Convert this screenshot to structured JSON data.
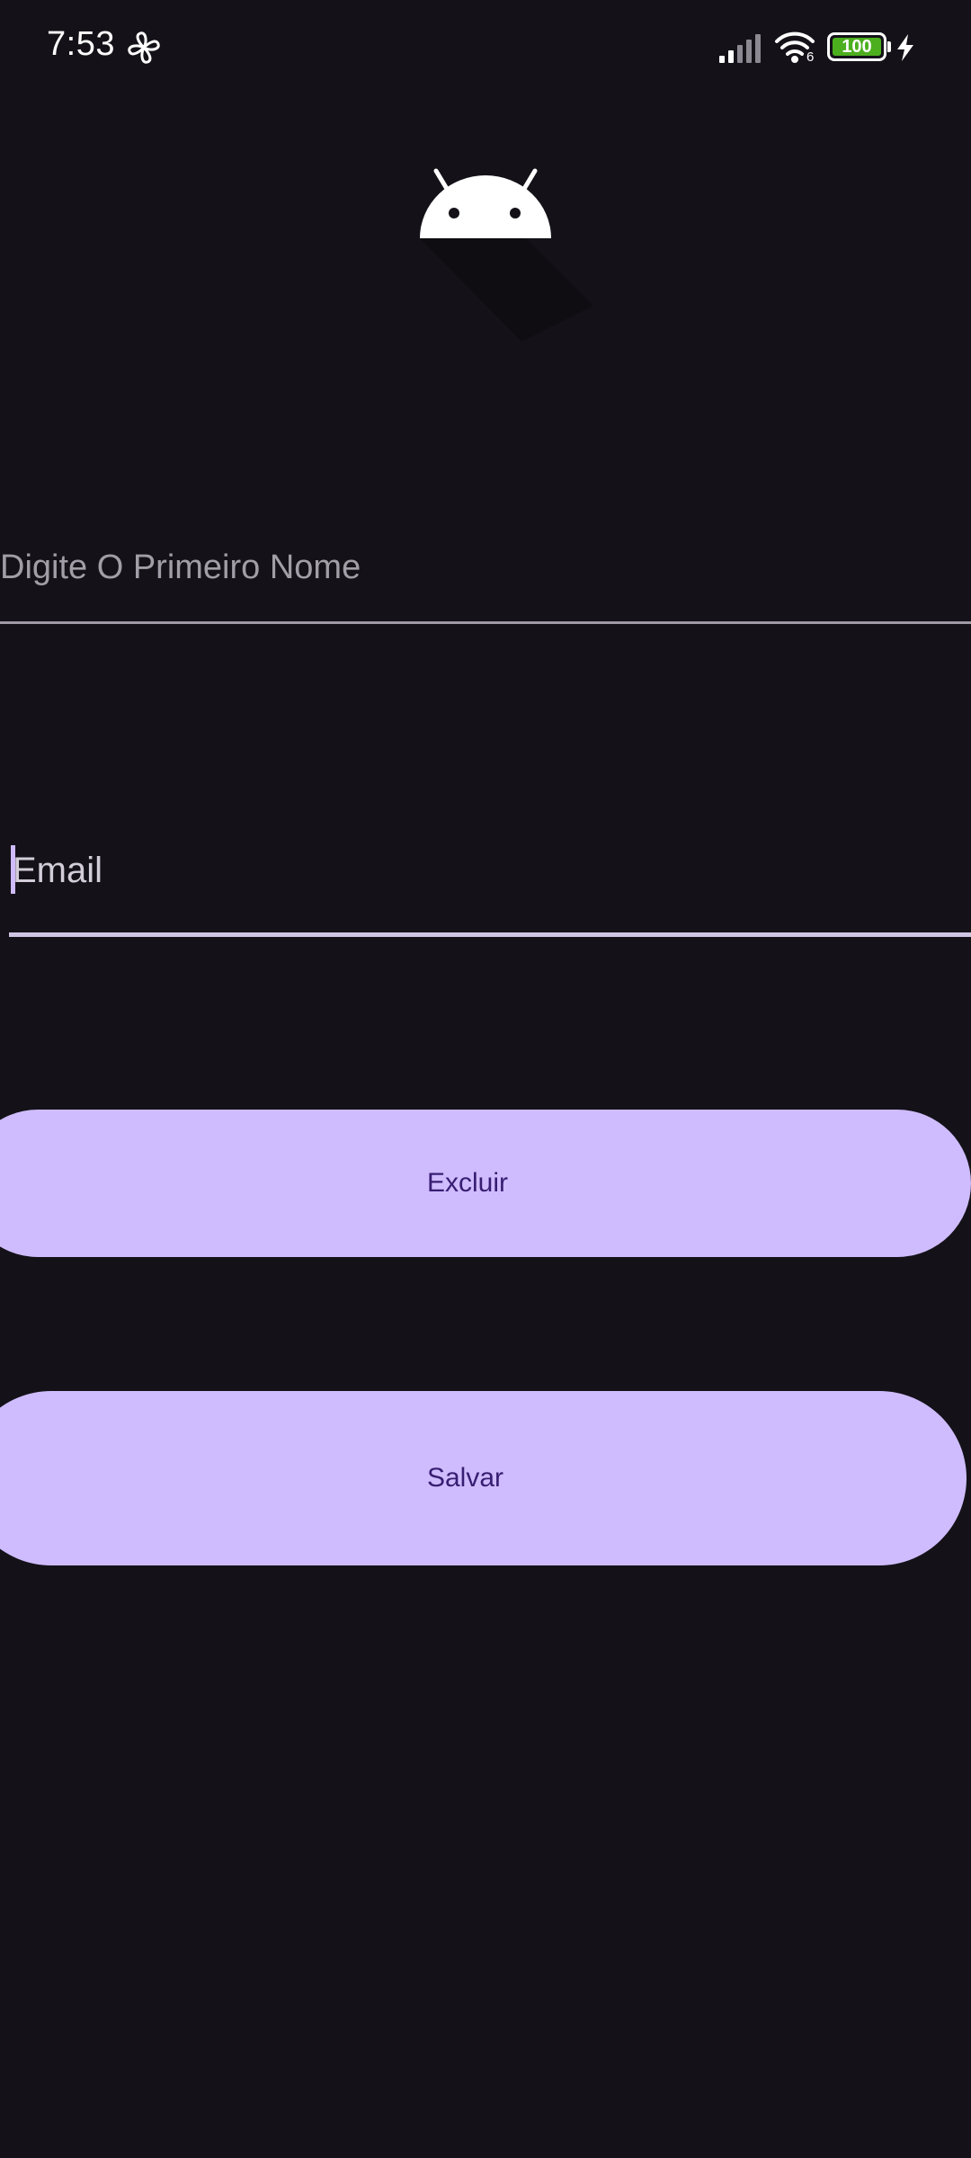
{
  "status_bar": {
    "time": "7:53",
    "wifi_label": "6",
    "battery_level": "100",
    "icons": [
      "fan-icon",
      "signal-icon",
      "wifi-icon",
      "battery-icon",
      "charging-bolt-icon"
    ],
    "battery_color": "#4CAF1E"
  },
  "logo": {
    "icon": "android-logo-icon"
  },
  "form": {
    "first_name_placeholder": "Digite O Primeiro Nome",
    "email_placeholder": "Email",
    "delete_label": "Excluir",
    "save_label": "Salvar"
  },
  "colors": {
    "background": "#141218",
    "button": "#CFBCFF",
    "button_text": "#381E72"
  }
}
